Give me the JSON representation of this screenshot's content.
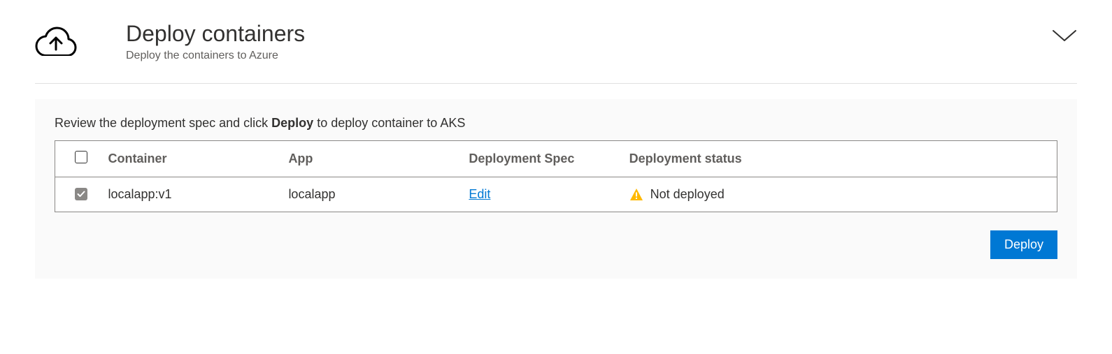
{
  "header": {
    "title": "Deploy containers",
    "subtitle": "Deploy the containers to Azure"
  },
  "instruction": {
    "prefix": "Review the deployment spec and click ",
    "bold": "Deploy",
    "suffix": " to deploy container to AKS"
  },
  "table": {
    "headers": {
      "container": "Container",
      "app": "App",
      "spec": "Deployment Spec",
      "status": "Deployment status"
    },
    "rows": [
      {
        "checked": true,
        "container": "localapp:v1",
        "app": "localapp",
        "spec_action": "Edit",
        "status_text": "Not deployed"
      }
    ]
  },
  "buttons": {
    "deploy": "Deploy"
  }
}
